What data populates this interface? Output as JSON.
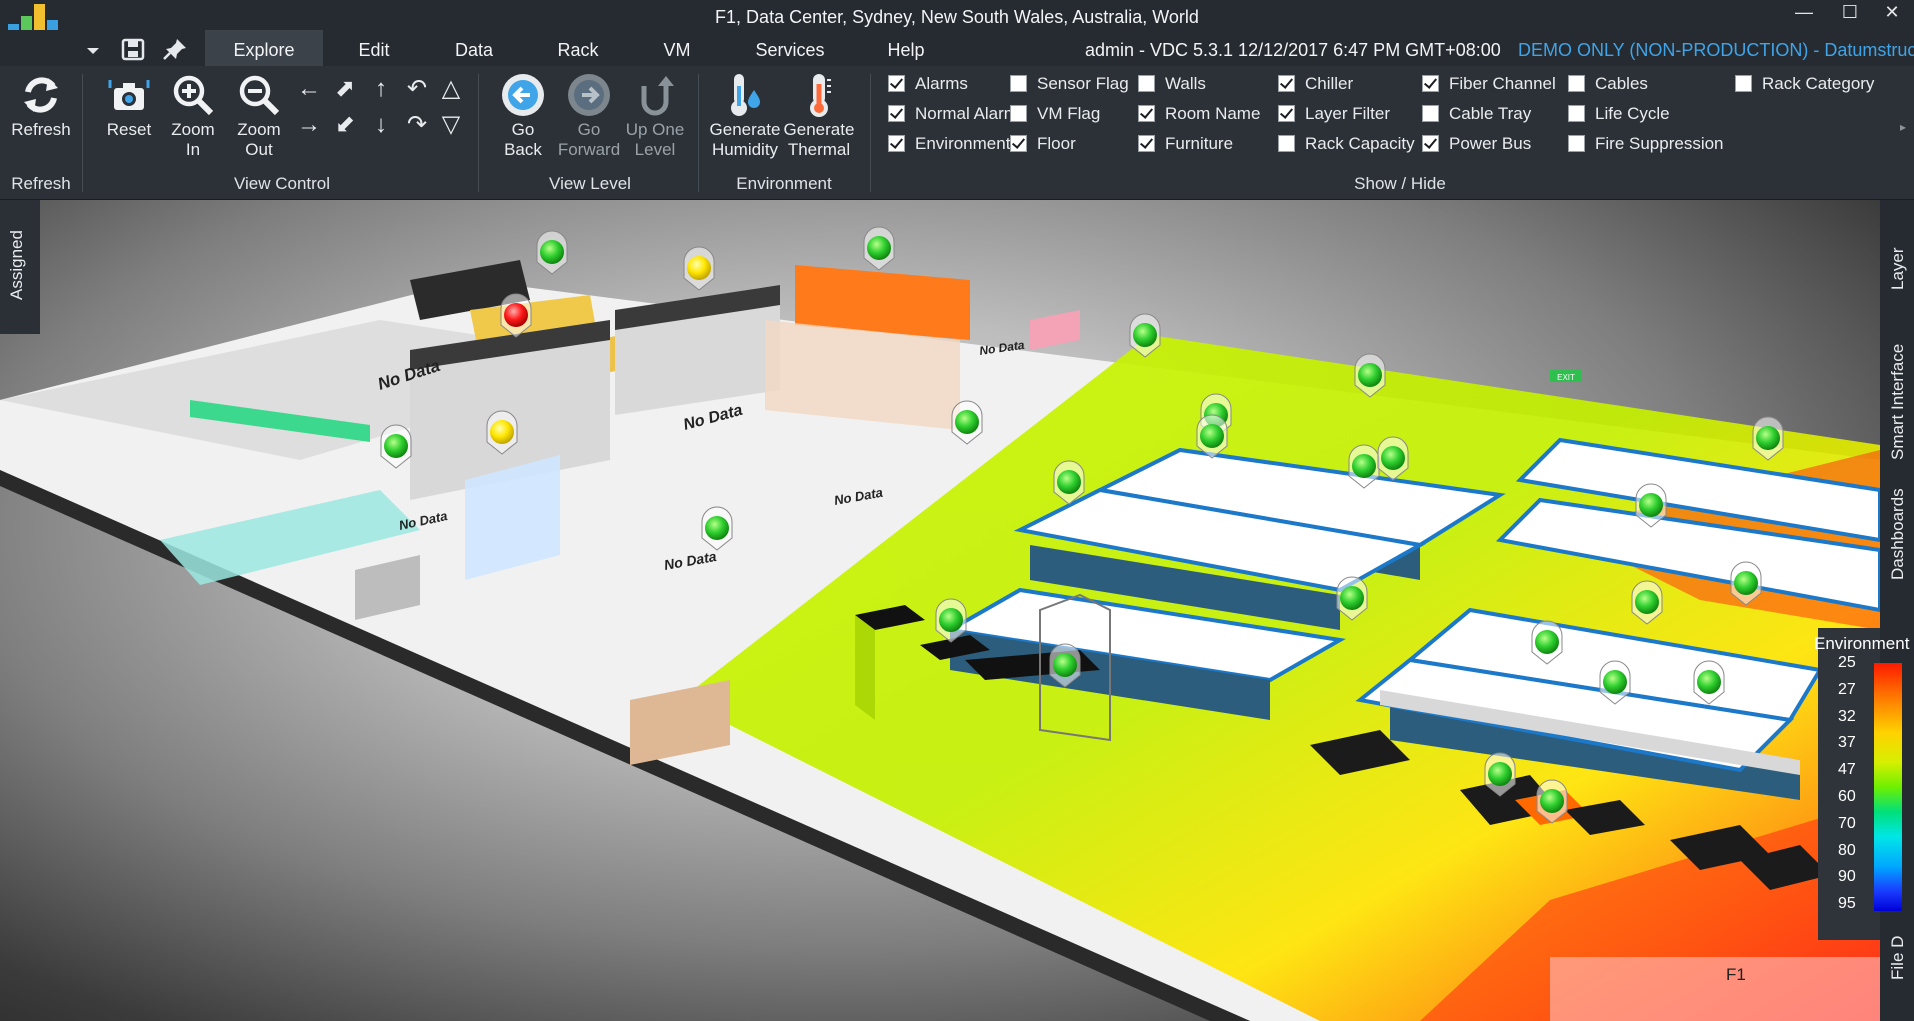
{
  "window": {
    "title": "F1, Data Center, Sydney, New South Wales, Australia, World",
    "controls": [
      "—",
      "☐",
      "✕"
    ]
  },
  "menu": {
    "tabs": [
      "Explore",
      "Edit",
      "Data",
      "Rack",
      "VM",
      "Services",
      "Help"
    ],
    "active_tab": "Explore",
    "status_user": "admin - VDC 5.3.1   12/12/2017 6:47 PM GMT+08:00",
    "status_demo": "DEMO ONLY (NON-PRODUCTION) - Datumstruct"
  },
  "ribbon": {
    "refresh": {
      "label": "Refresh",
      "group": "Refresh"
    },
    "view_control": {
      "group": "View Control",
      "reset": "Reset",
      "zoom_in": [
        "Zoom",
        "In"
      ],
      "zoom_out": [
        "Zoom",
        "Out"
      ]
    },
    "view_level": {
      "group": "View Level",
      "go_back": [
        "Go",
        "Back"
      ],
      "go_forward": [
        "Go",
        "Forward"
      ],
      "up_one_level": [
        "Up One",
        "Level"
      ]
    },
    "environment": {
      "group": "Environment",
      "generate_humidity": [
        "Generate",
        "Humidity"
      ],
      "generate_thermal": [
        "Generate",
        "Thermal"
      ]
    },
    "show_hide": {
      "group": "Show / Hide",
      "items": [
        {
          "label": "Alarms",
          "checked": true
        },
        {
          "label": "Normal Alarms",
          "checked": true
        },
        {
          "label": "Environment",
          "checked": true
        },
        {
          "label": "Sensor Flag",
          "checked": false
        },
        {
          "label": "VM Flag",
          "checked": false
        },
        {
          "label": "Floor",
          "checked": true
        },
        {
          "label": "Walls",
          "checked": false
        },
        {
          "label": "Room Name",
          "checked": true
        },
        {
          "label": "Furniture",
          "checked": true
        },
        {
          "label": "Chiller",
          "checked": true
        },
        {
          "label": "Layer Filter",
          "checked": true
        },
        {
          "label": "Rack Capacity",
          "checked": false
        },
        {
          "label": "Fiber Channel",
          "checked": true
        },
        {
          "label": "Cable Tray",
          "checked": false
        },
        {
          "label": "Power Bus",
          "checked": true
        },
        {
          "label": "Cables",
          "checked": false
        },
        {
          "label": "Life Cycle",
          "checked": false
        },
        {
          "label": "Fire Suppression",
          "checked": false
        },
        {
          "label": "Rack Category",
          "checked": false
        }
      ]
    }
  },
  "side_tabs": {
    "left": "Assigned",
    "right": [
      "Layer",
      "Smart Interface",
      "Dashboards",
      "File D"
    ]
  },
  "viewport": {
    "floor_label": "F1",
    "no_data_label": "No Data",
    "exit_sign": "EXIT",
    "legend": {
      "title": "Environment",
      "values": [
        "25",
        "27",
        "32",
        "37",
        "47",
        "60",
        "70",
        "80",
        "90",
        "95"
      ]
    }
  },
  "colors": {
    "accent_blue": "#3fa4e8",
    "alarm_green": "#2fcf2f",
    "alarm_yellow": "#ffe600",
    "alarm_red": "#ff1a1a",
    "heat_low": "#c8f500",
    "heat_high": "#ff2a10",
    "rack_blue": "#1c78c9"
  }
}
